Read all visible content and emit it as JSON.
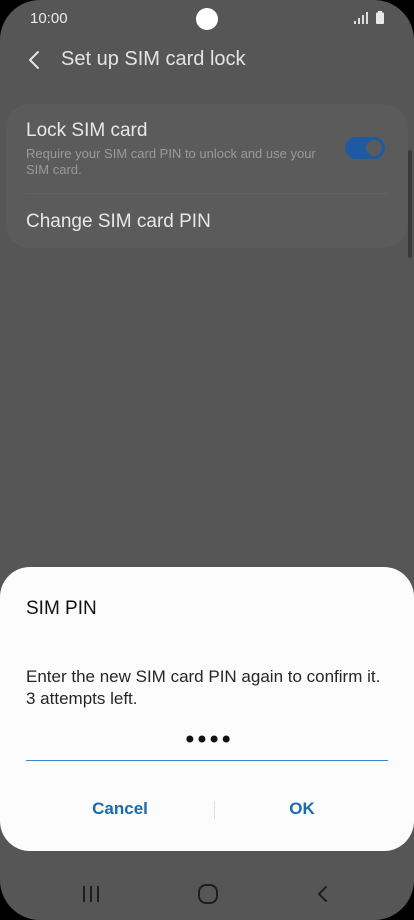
{
  "status_bar": {
    "time": "10:00",
    "icons": [
      "signal-icon",
      "battery-icon"
    ]
  },
  "app_bar": {
    "title": "Set up SIM card lock",
    "back_icon": "back-icon"
  },
  "settings": {
    "lock_sim": {
      "title": "Lock SIM card",
      "description": "Require your SIM card PIN to unlock and use your SIM card.",
      "enabled": true
    },
    "change_pin": {
      "title": "Change SIM card PIN"
    }
  },
  "dialog": {
    "title": "SIM PIN",
    "message_line1": "Enter the new SIM card PIN again to confirm it.",
    "message_line2": "3 attempts left.",
    "pin_value": "••••",
    "cancel_label": "Cancel",
    "ok_label": "OK"
  },
  "nav_bar": {
    "icons": [
      "recents-icon",
      "home-icon",
      "back-icon"
    ]
  },
  "colors": {
    "accent": "#1b6aa9",
    "toggle_on": "#1d5aa1",
    "dim_background": "#565656"
  }
}
